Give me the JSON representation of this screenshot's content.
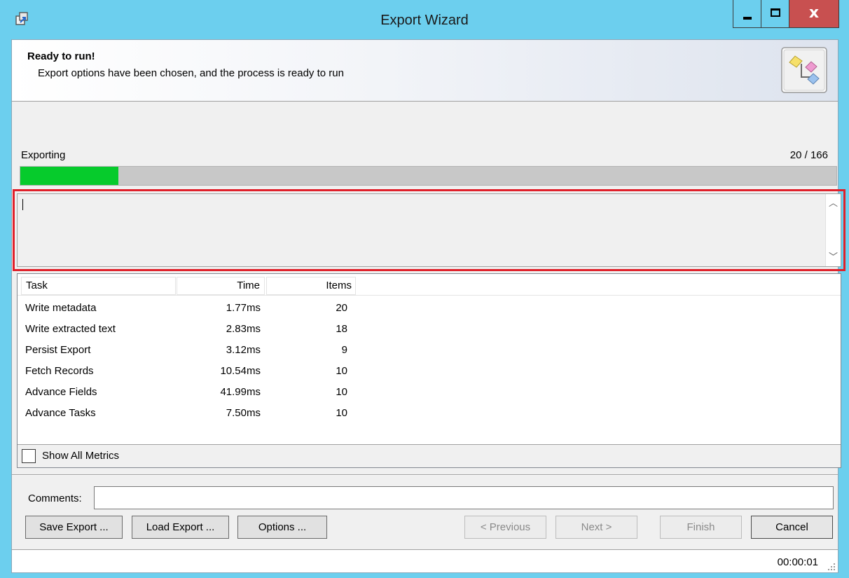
{
  "window": {
    "title": "Export Wizard",
    "title_bar_color": "#6ccfee",
    "close_color": "#c85050"
  },
  "header": {
    "title": "Ready to run!",
    "subtitle": "Export options have been chosen, and the process is ready to run",
    "icon": "export-wizard-icon"
  },
  "progress": {
    "label": "Exporting",
    "count": "20 / 166",
    "current": 20,
    "total": 166,
    "fraction": 0.12,
    "fill_color": "#06cb2c"
  },
  "log": {
    "text": ""
  },
  "metrics": {
    "columns": [
      "Task",
      "Time",
      "Items"
    ],
    "rows": [
      {
        "task": "Write metadata",
        "time": "1.77ms",
        "items": "20"
      },
      {
        "task": "Write extracted text",
        "time": "2.83ms",
        "items": "18"
      },
      {
        "task": "Persist Export",
        "time": "3.12ms",
        "items": "9"
      },
      {
        "task": "Fetch Records",
        "time": "10.54ms",
        "items": "10"
      },
      {
        "task": "Advance Fields",
        "time": "41.99ms",
        "items": "10"
      },
      {
        "task": "Advance Tasks",
        "time": "7.50ms",
        "items": "10"
      }
    ],
    "show_all_label": "Show All Metrics",
    "show_all_checked": false
  },
  "comments": {
    "label": "Comments:",
    "value": ""
  },
  "buttons": {
    "save": "Save Export ...",
    "load": "Load Export ...",
    "options": "Options ...",
    "previous": "< Previous",
    "next": "Next >",
    "finish": "Finish",
    "cancel": "Cancel"
  },
  "status": {
    "elapsed": "00:00:01"
  },
  "accent": {
    "highlight_border": "#e0202a"
  }
}
